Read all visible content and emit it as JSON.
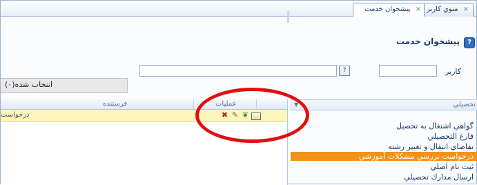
{
  "tabs": [
    {
      "label": "پيشخوان خدمت",
      "close": "×"
    },
    {
      "label": "منوي كاربر",
      "close": "×"
    }
  ],
  "page": {
    "title": "پيشخوان خدمت",
    "help_icon": "question-icon"
  },
  "filters": {
    "user_label": "كاربر",
    "user_value": "",
    "main_value": "",
    "picker_symbol": "?",
    "selected_label": "انتخاب شده(٠)"
  },
  "grid": {
    "columns": {
      "sender": "فرستنده",
      "operations": "عمليات"
    },
    "row": {
      "text": "درخواست",
      "ops": [
        "delete-icon",
        "edit-icon",
        "tree-icon",
        "folder-icon"
      ]
    },
    "op_symbols": {
      "delete": "✖",
      "edit": "✎",
      "tree": "❦"
    }
  },
  "service_list": {
    "title": "تحصيلي",
    "items": [
      "گواهي اشتغال به تحصيل",
      "فارغ التحصيلي",
      "تقاضاي انتقال و تغيير رشته",
      "درخواست بررسي مشكلات آموزشي",
      "ثبت نام اصلي",
      "ارسال مدارك تحصيلي"
    ],
    "selected_index": 3
  },
  "colors": {
    "highlight_row": "#fdf5bb",
    "selected_item": "#f2921a",
    "annotation": "#e01010"
  }
}
